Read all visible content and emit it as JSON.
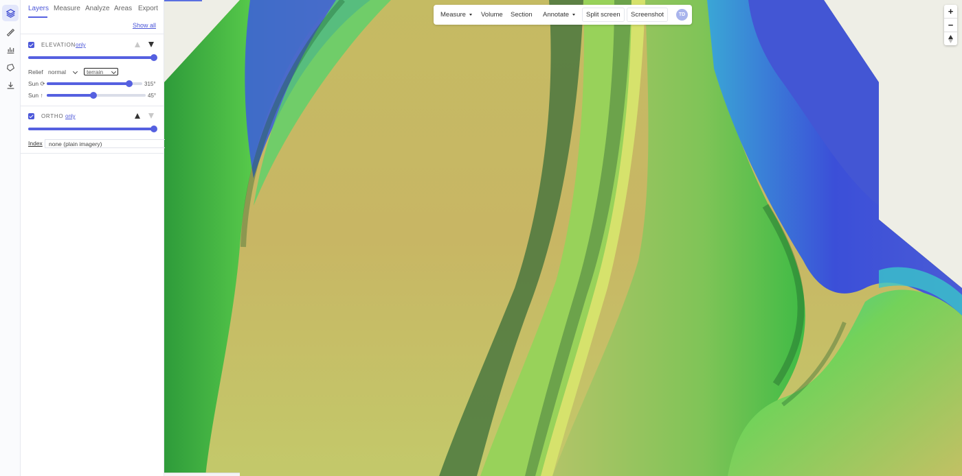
{
  "panel": {
    "tabs": [
      {
        "label": "Layers"
      },
      {
        "label": "Measure"
      },
      {
        "label": "Analyze"
      },
      {
        "label": "Areas"
      },
      {
        "label": "Export"
      }
    ],
    "show_all": "Show all",
    "layers": [
      {
        "name": "ELEVATION",
        "only": "only",
        "visible": true,
        "opacity": 1.0
      },
      {
        "name": "ORTHO",
        "only": "only",
        "visible": true,
        "opacity": 1.0
      }
    ],
    "relief": {
      "label": "Relief",
      "mode": "normal",
      "palette": "terrain"
    },
    "sun_azimuth": {
      "label": "Sun ⟳",
      "value": 315,
      "display": "315°"
    },
    "sun_altitude": {
      "label": "Sun ↑",
      "value": 45,
      "display": "45°"
    },
    "index": {
      "label": "Index",
      "value": "none (plain imagery)"
    }
  },
  "toolbar": {
    "measure": "Measure",
    "volume": "Volume",
    "section": "Section",
    "annotate": "Annotate",
    "split_screen": "Split screen",
    "screenshot": "Screenshot",
    "avatar_initials": "TD"
  },
  "zoom": {
    "in": "+",
    "out": "−"
  },
  "icons": {
    "rail": [
      "layers-icon",
      "measure-icon",
      "chart-icon",
      "polygon-icon",
      "download-icon"
    ],
    "compass": "compass-icon"
  },
  "colors": {
    "accent": "#5560e0"
  }
}
